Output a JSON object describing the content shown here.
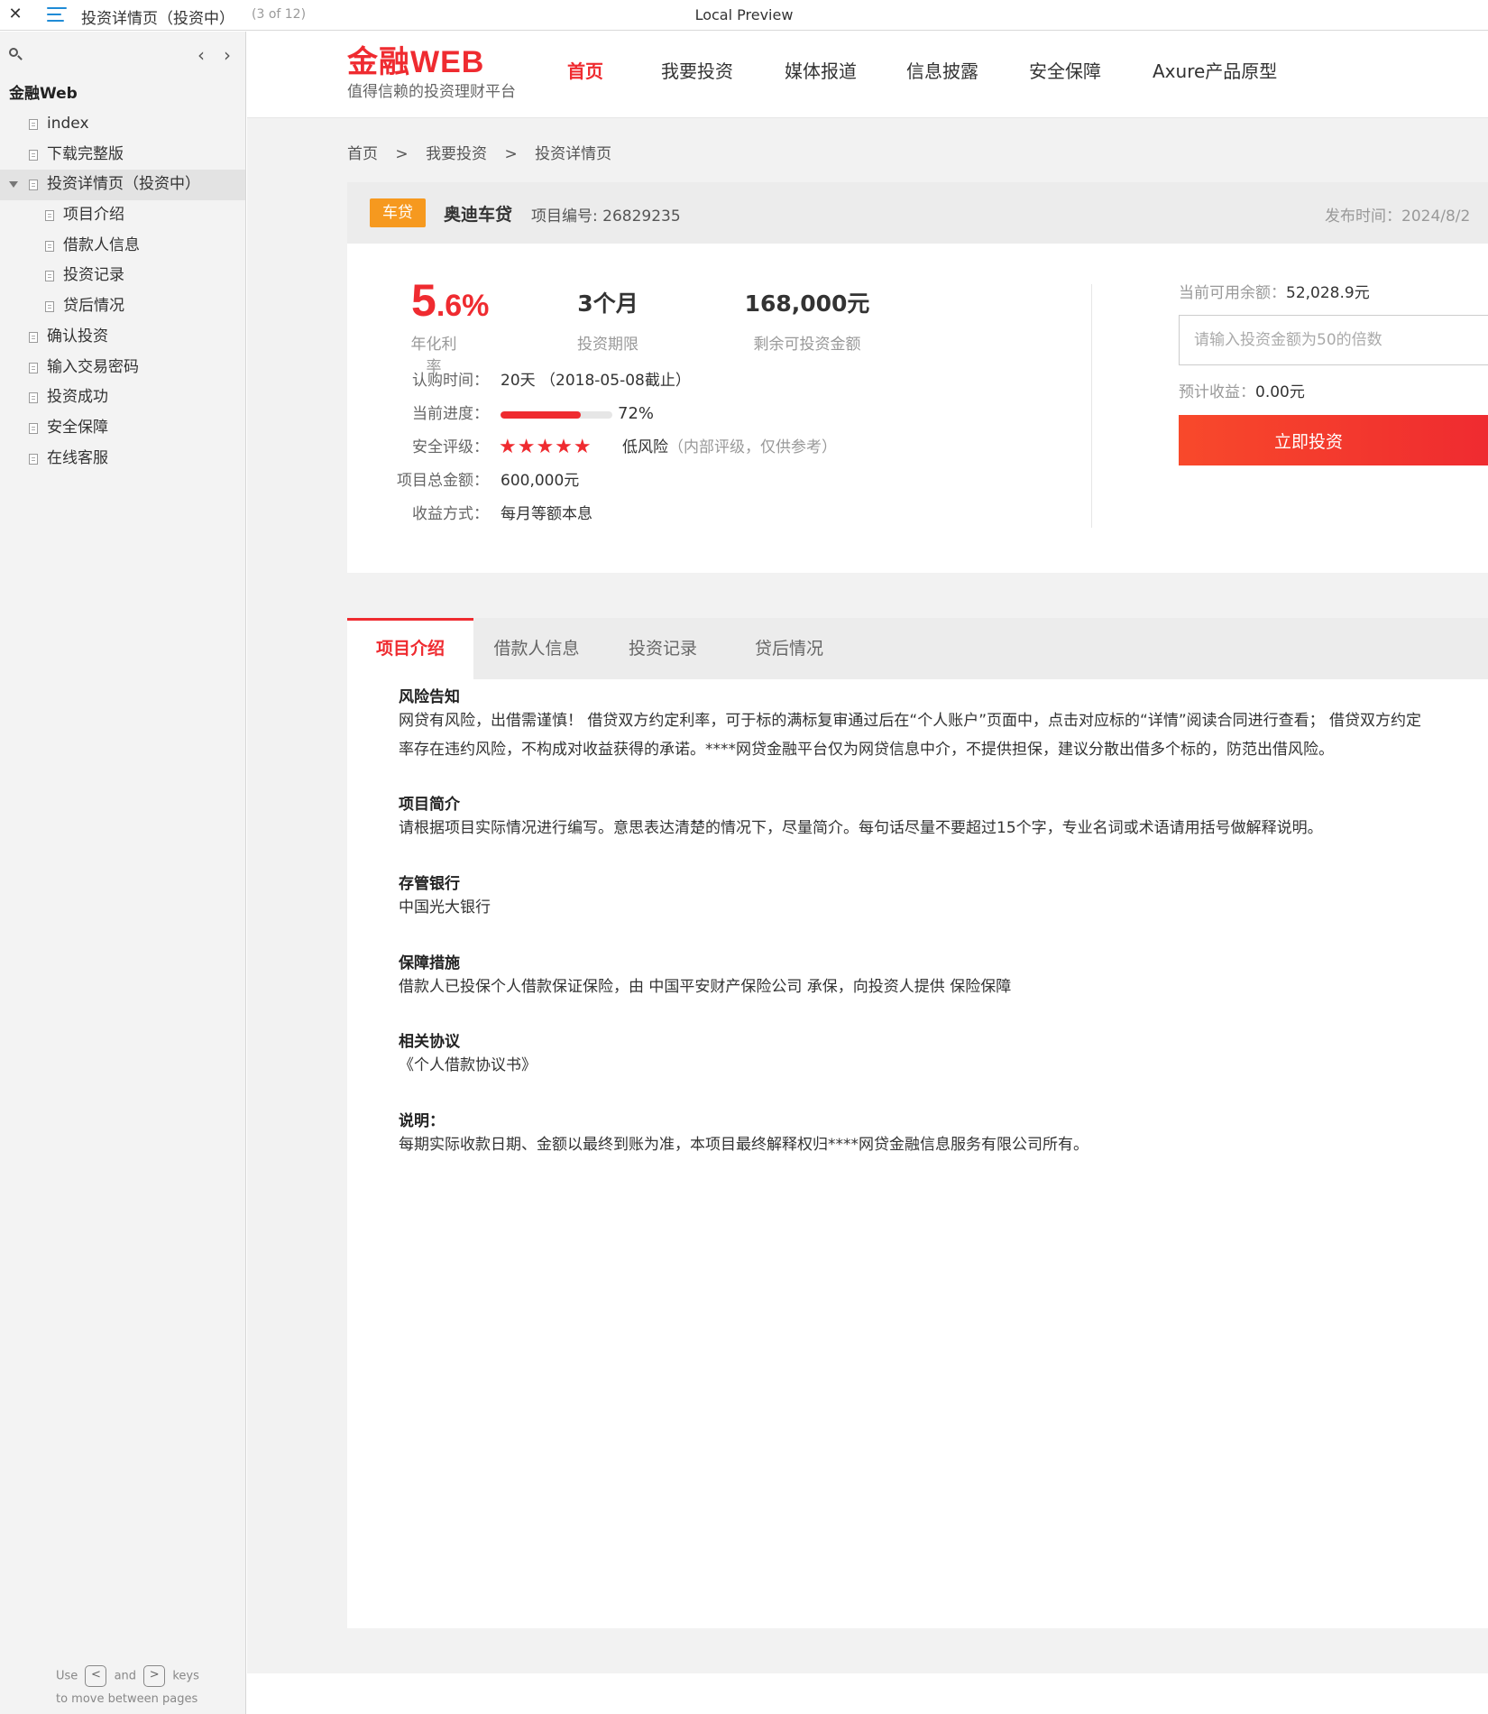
{
  "topbar": {
    "close_glyph": "✕",
    "page_title": "投资详情页（投资中）",
    "page_count": "(3 of 12)",
    "preview_title": "Local Preview"
  },
  "sidebar": {
    "prev_glyph": "‹",
    "next_glyph": "›",
    "root": "金融Web",
    "items": [
      {
        "label": "index",
        "level": 1
      },
      {
        "label": "下载完整版",
        "level": 1
      },
      {
        "label": "投资详情页（投资中）",
        "level": 1,
        "expanded": true,
        "active": true
      },
      {
        "label": "项目介绍",
        "level": 2
      },
      {
        "label": "借款人信息",
        "level": 2
      },
      {
        "label": "投资记录",
        "level": 2
      },
      {
        "label": "贷后情况",
        "level": 2
      },
      {
        "label": "确认投资",
        "level": 1
      },
      {
        "label": "输入交易密码",
        "level": 1
      },
      {
        "label": "投资成功",
        "level": 1
      },
      {
        "label": "安全保障",
        "level": 1
      },
      {
        "label": "在线客服",
        "level": 1
      }
    ],
    "hint": {
      "use": "Use",
      "and": "and",
      "keys": "keys",
      "line2": "to move between pages",
      "key_prev": "<",
      "key_next": ">"
    }
  },
  "header": {
    "logo": "金融WEB",
    "slogan": "值得信赖的投资理财平台",
    "nav": [
      "首页",
      "我要投资",
      "媒体报道",
      "信息披露",
      "安全保障",
      "Axure产品原型"
    ],
    "active_nav": 0
  },
  "breadcrumb": {
    "items": [
      "首页",
      "我要投资",
      "投资详情页"
    ],
    "separator": ">"
  },
  "project": {
    "tag": "车贷",
    "name": "奥迪车贷",
    "code": "项目编号: 26829235",
    "publish_time": "发布时间：2024/8/2"
  },
  "summary": {
    "rate_int": "5",
    "rate_dec": ".6%",
    "rate_label": "年化利率",
    "term_value": "3个月",
    "term_label": "投资期限",
    "remaining_value": "168,000元",
    "remaining_label": "剩余可投资金额",
    "subscribe_label": "认购时间：",
    "subscribe_value": "20天 （2018-05-08截止）",
    "progress_label": "当前进度：",
    "progress_percent": 72,
    "progress_text": "72%",
    "safety_label": "安全评级：",
    "stars": "★★★★★",
    "star_rating": 5,
    "risk": "低风险",
    "risk_note": "（内部评级，仅供参考）",
    "total_label": "项目总金额：",
    "total_value": "600,000元",
    "repay_label": "收益方式：",
    "repay_value": "每月等额本息",
    "balance_label": "当前可用余额：",
    "balance_value": "52,028.9元",
    "amount_placeholder": "请输入投资金额为50的倍数",
    "expect_label": "预计收益：",
    "expect_value": "0.00元",
    "invest_button": "立即投资"
  },
  "tabs": [
    "项目介绍",
    "借款人信息",
    "投资记录",
    "贷后情况"
  ],
  "active_tab": 0,
  "details": [
    {
      "title": "风险告知",
      "lines": [
        "网贷有风险，出借需谨慎！ 借贷双方约定利率，可于标的满标复审通过后在“个人账户”页面中，点击对应标的“详情”阅读合同进行查看； 借贷双方约定",
        "率存在违约风险，不构成对收益获得的承诺。****网贷金融平台仅为网贷信息中介，不提供担保，建议分散出借多个标的，防范出借风险。"
      ]
    },
    {
      "title": "项目简介",
      "lines": [
        "请根据项目实际情况进行编写。意思表达清楚的情况下，尽量简介。每句话尽量不要超过15个字，专业名词或术语请用括号做解释说明。"
      ]
    },
    {
      "title": "存管银行",
      "lines": [
        "中国光大银行"
      ]
    },
    {
      "title": "保障措施",
      "lines": [
        "借款人已投保个人借款保证保险，由 中国平安财产保险公司 承保，向投资人提供 保险保障"
      ]
    },
    {
      "title": "相关协议",
      "lines": [
        "《个人借款协议书》"
      ]
    },
    {
      "title": "说明：",
      "lines": [
        "每期实际收款日期、金额以最终到账为准，本项目最终解释权归****网贷金融信息服务有限公司所有。"
      ]
    }
  ]
}
